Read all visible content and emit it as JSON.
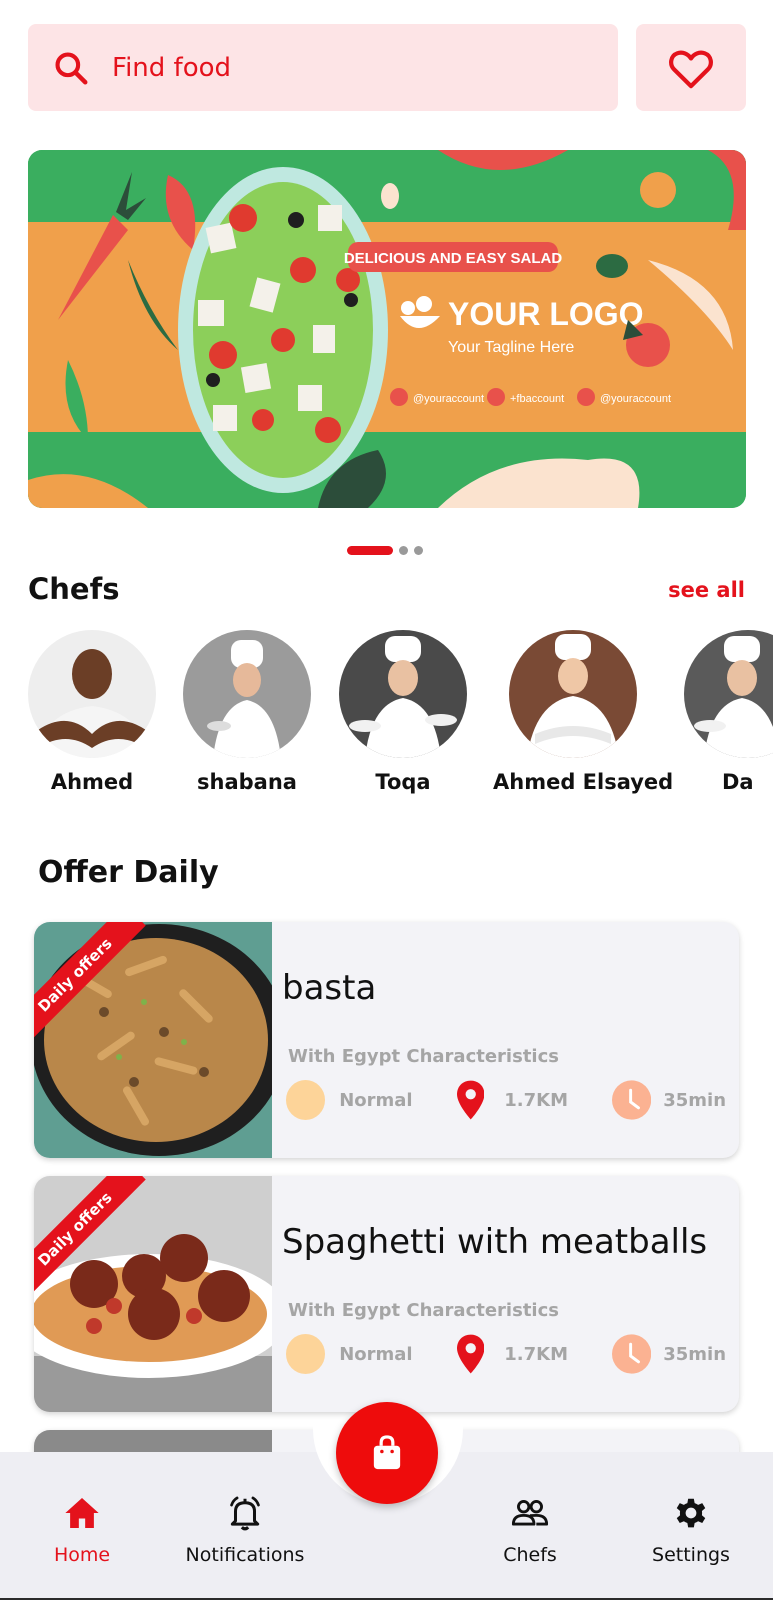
{
  "search": {
    "placeholder": "Find food"
  },
  "banner": {
    "badge": "DELICIOUS AND EASY SALAD",
    "logo": "YOUR LOGO",
    "tagline": "Your Tagline Here",
    "social": [
      "@youraccount",
      "+fbaccount",
      "@youraccount"
    ]
  },
  "carousel": {
    "active_index": 0,
    "count": 3
  },
  "chefs": {
    "title": "Chefs",
    "see_all": "see all",
    "items": [
      {
        "name": "Ahmed"
      },
      {
        "name": "shabana"
      },
      {
        "name": "Toqa"
      },
      {
        "name": "Ahmed Elsayed"
      },
      {
        "name": "Da"
      }
    ]
  },
  "offers": {
    "title": "Offer Daily",
    "ribbon": "Daily offers",
    "items": [
      {
        "title": "basta",
        "subtitle": "With Egypt Characteristics",
        "level": "Normal",
        "distance": "1.7KM",
        "time": "35min"
      },
      {
        "title": "Spaghetti with meatballs",
        "subtitle": "With Egypt Characteristics",
        "level": "Normal",
        "distance": "1.7KM",
        "time": "35min"
      }
    ]
  },
  "nav": {
    "home": "Home",
    "notifications": "Notifications",
    "chefs": "Chefs",
    "settings": "Settings"
  },
  "colors": {
    "accent": "#e4121c",
    "search_bg": "#fde4e6",
    "nav_bg": "#eeeef3"
  }
}
